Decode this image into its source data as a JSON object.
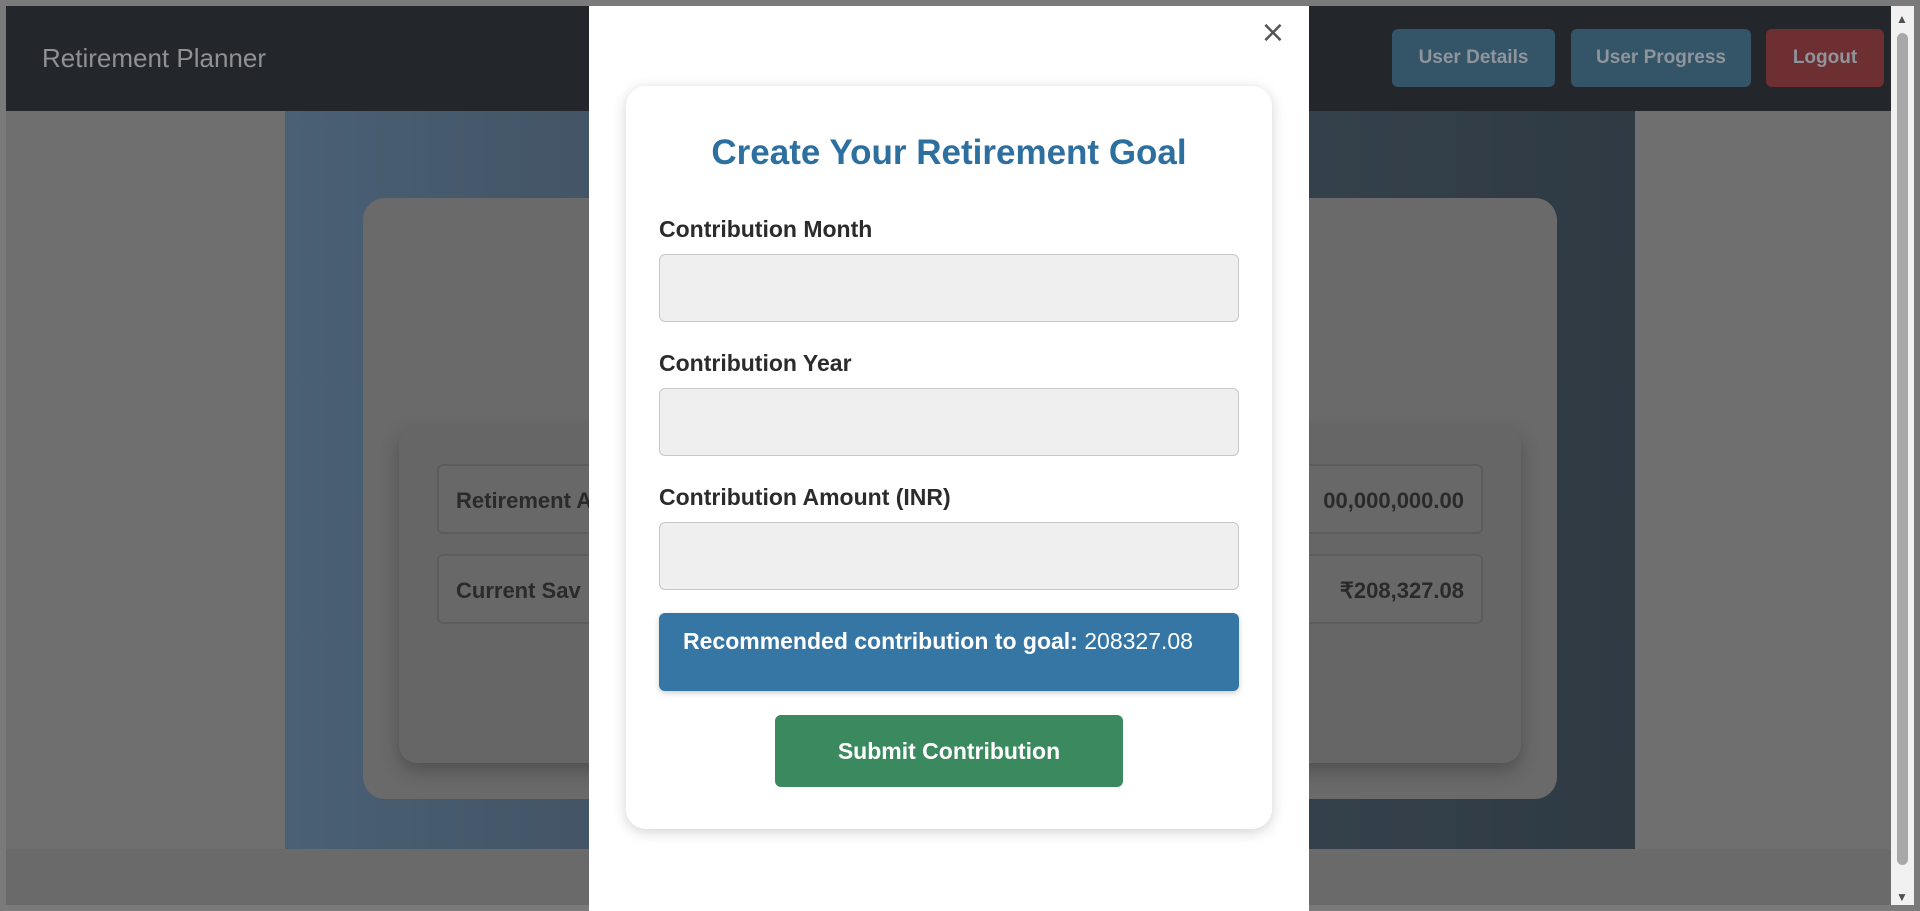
{
  "navbar": {
    "brand": "Retirement Planner",
    "buttons": {
      "user_details": "User Details",
      "user_progress": "User Progress",
      "logout": "Logout"
    }
  },
  "summary": {
    "rows": [
      {
        "label": "Retirement A",
        "value": "00,000,000.00"
      },
      {
        "label": "Current Sav",
        "value": "₹208,327.08"
      }
    ]
  },
  "modal": {
    "close_icon": "×",
    "title": "Create Your Retirement Goal",
    "fields": {
      "month_label": "Contribution Month",
      "month_value": "",
      "year_label": "Contribution Year",
      "year_value": "",
      "amount_label": "Contribution Amount (INR)",
      "amount_value": ""
    },
    "recommendation": {
      "label": "Recommended contribution to goal:",
      "value": "208327.08"
    },
    "submit_label": "Submit Contribution"
  },
  "colors": {
    "navbar_bg": "#23262a",
    "title_blue": "#2d6f9f",
    "recommend_bg": "#3676a5",
    "submit_green": "#3b8a5f",
    "logout_red": "#c0392b",
    "nav_button_blue": "#2e6f9f"
  },
  "scrollbar": {
    "up_arrow": "▲",
    "down_arrow": "▼"
  }
}
